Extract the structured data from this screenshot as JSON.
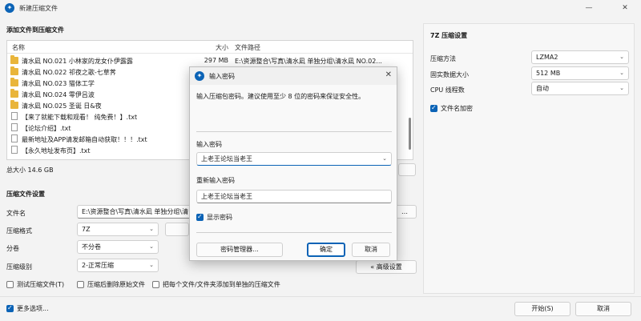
{
  "window": {
    "title": "新建压缩文件"
  },
  "files": {
    "section_title": "添加文件到压缩文件",
    "columns": [
      "名称",
      "大小",
      "文件路径"
    ],
    "rows": [
      {
        "type": "folder",
        "name": "清水凪 NO.021 小林家的龙女仆伊露露",
        "size": "297 MB",
        "path": "E:\\资源整合\\写真\\清水凪 单独分组\\清水凪 NO.02..."
      },
      {
        "type": "folder",
        "name": "清水凪 NO.022 祁夜之歌-七草荠",
        "size": "",
        "path": ""
      },
      {
        "type": "folder",
        "name": "清水凪 NO.023 猫体工学",
        "size": "",
        "path": ""
      },
      {
        "type": "folder",
        "name": "清水凪 NO.024 零伊吕波",
        "size": "",
        "path": ""
      },
      {
        "type": "folder",
        "name": "清水凪 NO.025 圣诞 日&夜",
        "size": "",
        "path": ""
      },
      {
        "type": "txt",
        "name": "【来了就能下载和观看！ 纯免费！】.txt",
        "size": "",
        "path": ""
      },
      {
        "type": "txt",
        "name": "【论坛介绍】.txt",
        "size": "",
        "path": ""
      },
      {
        "type": "txt",
        "name": "最新地址及APP请发邮箱自动获取！！！.txt",
        "size": "",
        "path": ""
      },
      {
        "type": "txt",
        "name": "【永久地址发布页】.txt",
        "size": "",
        "path": ""
      }
    ],
    "total_size": "总大小 14.6 GB"
  },
  "settings": {
    "section_title": "压缩文件设置",
    "filename_label": "文件名",
    "filename_value": "E:\\资源整合\\写真\\清水凪 单独分组\\清",
    "format_label": "压缩格式",
    "format_value": "7Z",
    "split_label": "分卷",
    "split_value": "不分卷",
    "level_label": "压缩级别",
    "level_value": "2-正常压缩",
    "advanced_button": "« 高级设置",
    "test_archive": "测试压缩文件(T)",
    "delete_after": "压缩后删除原始文件",
    "each_separate": "把每个文件/文件夹添加到单独的压缩文件"
  },
  "right_panel": {
    "title": "7Z 压缩设置",
    "method_label": "压缩方法",
    "method_value": "LZMA2",
    "dict_label": "固实数据大小",
    "dict_value": "512 MB",
    "threads_label": "CPU 线程数",
    "threads_value": "自动",
    "encrypt_names": "文件名加密"
  },
  "bottom": {
    "more_options": "更多选项...",
    "start_button": "开始(S)",
    "cancel_button": "取消"
  },
  "dialog": {
    "title": "输入密码",
    "message": "输入压缩包密码。建议使用至少 8 位的密码来保证安全性。",
    "password_label": "输入密码",
    "password_value": "上老王论坛当老王",
    "reenter_label": "重新输入密码",
    "reenter_value": "上老王论坛当老王",
    "show_password": "显示密码",
    "manager_button": "密码管理器...",
    "ok_button": "确定",
    "cancel_button": "取消"
  },
  "colors": {
    "accent": "#0b63b6",
    "folder": "#e9b53b"
  }
}
